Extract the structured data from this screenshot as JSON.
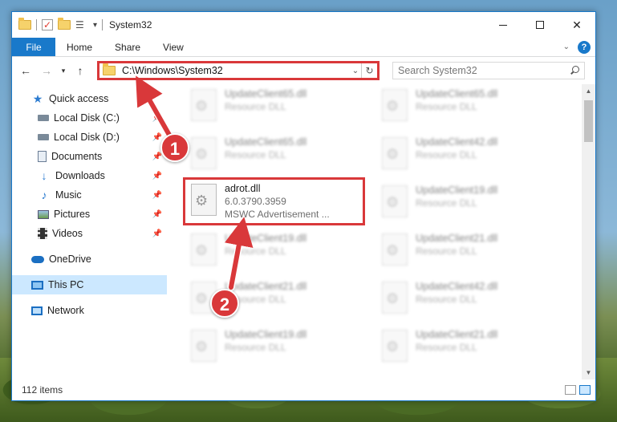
{
  "window": {
    "title": "System32"
  },
  "ribbon": {
    "tabs": [
      "File",
      "Home",
      "Share",
      "View"
    ]
  },
  "address_bar": {
    "path": "C:\\Windows\\System32"
  },
  "search": {
    "placeholder": "Search System32"
  },
  "sidebar": {
    "items": [
      {
        "label": "Quick access",
        "icon": "star-icon",
        "pinned": false
      },
      {
        "label": "Local Disk (C:)",
        "icon": "drive-icon",
        "pinned": true
      },
      {
        "label": "Local Disk (D:)",
        "icon": "drive-icon",
        "pinned": true
      },
      {
        "label": "Documents",
        "icon": "document-icon",
        "pinned": true
      },
      {
        "label": "Downloads",
        "icon": "download-icon",
        "pinned": true
      },
      {
        "label": "Music",
        "icon": "music-icon",
        "pinned": true
      },
      {
        "label": "Pictures",
        "icon": "pictures-icon",
        "pinned": true
      },
      {
        "label": "Videos",
        "icon": "video-icon",
        "pinned": true
      },
      {
        "label": "OneDrive",
        "icon": "cloud-icon",
        "pinned": false
      },
      {
        "label": "This PC",
        "icon": "computer-icon",
        "pinned": false,
        "selected": true
      },
      {
        "label": "Network",
        "icon": "network-icon",
        "pinned": false
      }
    ]
  },
  "files": [
    {
      "name": "UpdateClient65.dll",
      "type": "Resource DLL",
      "blurred": true
    },
    {
      "name": "UpdateClient65.dll",
      "type": "Resource DLL",
      "blurred": true
    },
    {
      "name": "UpdateClient65.dll",
      "type": "Resource DLL",
      "blurred": true
    },
    {
      "name": "UpdateClient42.dll",
      "type": "Resource DLL",
      "blurred": true
    },
    {
      "name": "adrot.dll",
      "version": "6.0.3790.3959",
      "type": "MSWC Advertisement ...",
      "blurred": false,
      "highlighted": true
    },
    {
      "name": "UpdateClient19.dll",
      "type": "Resource DLL",
      "blurred": true
    },
    {
      "name": "UpdateClient19.dll",
      "type": "Resource DLL",
      "blurred": true
    },
    {
      "name": "UpdateClient21.dll",
      "type": "Resource DLL",
      "blurred": true
    },
    {
      "name": "UpdateClient21.dll",
      "type": "Resource DLL",
      "blurred": true
    },
    {
      "name": "UpdateClient42.dll",
      "type": "Resource DLL",
      "blurred": true
    },
    {
      "name": "UpdateClient19.dll",
      "type": "Resource DLL",
      "blurred": true
    },
    {
      "name": "UpdateClient21.dll",
      "type": "Resource DLL",
      "blurred": true
    }
  ],
  "status": {
    "item_count": "112 items"
  },
  "callouts": [
    "1",
    "2"
  ],
  "colors": {
    "accent": "#1979ca",
    "highlight": "#d9383a",
    "selection": "#cce8ff"
  }
}
